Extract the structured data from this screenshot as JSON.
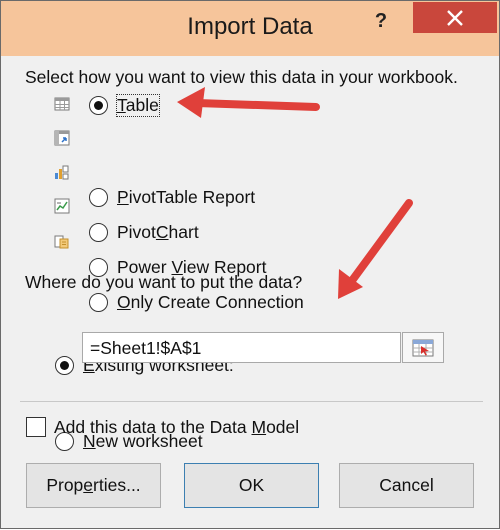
{
  "window": {
    "title": "Import Data",
    "help_symbol": "?"
  },
  "view_section": {
    "prompt": "Select how you want to view this data in your workbook.",
    "options": [
      {
        "pre": "",
        "key": "T",
        "post": "able",
        "icon": "table-icon",
        "selected": true
      },
      {
        "pre": "",
        "key": "P",
        "post": "ivotTable Report",
        "icon": "pivottable-icon",
        "selected": false
      },
      {
        "pre": "Pivot",
        "key": "C",
        "post": "hart",
        "icon": "pivotchart-icon",
        "selected": false
      },
      {
        "pre": "Power ",
        "key": "V",
        "post": "iew Report",
        "icon": "power-view-icon",
        "selected": false
      },
      {
        "pre": "",
        "key": "O",
        "post": "nly Create Connection",
        "icon": "connection-icon",
        "selected": false
      }
    ]
  },
  "destination_section": {
    "prompt": "Where do you want to put the data?",
    "existing": {
      "key": "E",
      "post": "xisting worksheet:",
      "selected": true
    },
    "reference_value": "=Sheet1!$A$1",
    "new": {
      "key": "N",
      "post": "ew worksheet",
      "selected": false
    }
  },
  "data_model": {
    "pre": "Add this data to the Data ",
    "key": "M",
    "post": "odel",
    "checked": false
  },
  "buttons": {
    "properties": {
      "pre": "Prop",
      "key": "e",
      "post": "rties..."
    },
    "ok": "OK",
    "cancel": "Cancel"
  },
  "colors": {
    "title_bar": "#f6c59b",
    "close_button": "#c9473c",
    "dialog_background": "#f0f0f0",
    "annotation_arrow": "#e0403a"
  }
}
